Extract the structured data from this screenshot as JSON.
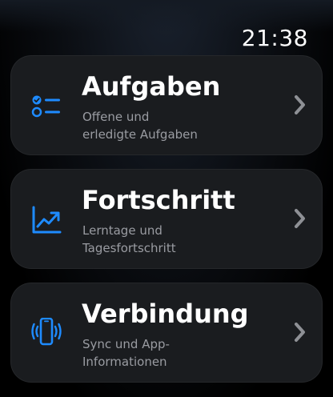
{
  "status": {
    "time": "21:38"
  },
  "menu": {
    "items": [
      {
        "title": "Aufgaben",
        "subtitle_line1": "Offene und",
        "subtitle_line2": "erledigte Aufgaben",
        "icon": "checklist-icon"
      },
      {
        "title": "Fortschritt",
        "subtitle_line1": "Lerntage und",
        "subtitle_line2": "Tagesfortschritt",
        "icon": "trend-chart-icon"
      },
      {
        "title": "Verbindung",
        "subtitle_line1": "Sync und App-",
        "subtitle_line2": "Informationen",
        "icon": "phone-connection-icon"
      }
    ]
  },
  "colors": {
    "accent": "#1e8bff",
    "card": "#1a1c1f",
    "text": "#ffffff",
    "subtext": "#9a9ca2",
    "chevron": "#8e9095"
  }
}
